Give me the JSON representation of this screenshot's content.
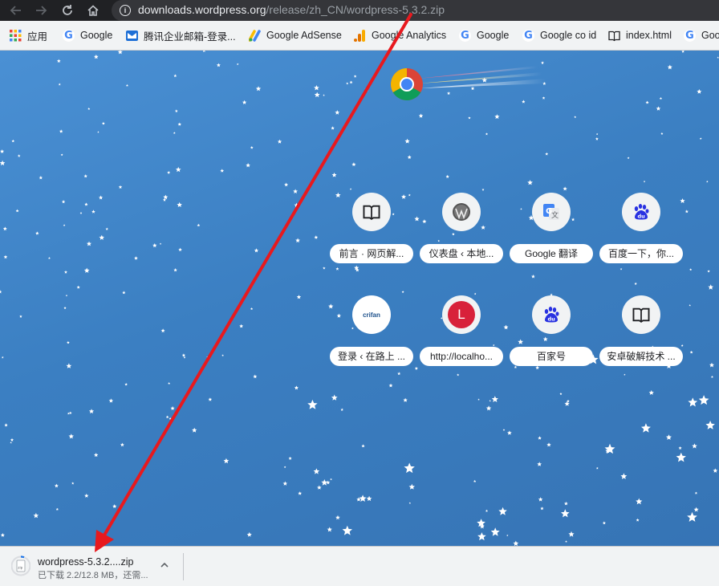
{
  "omnibox": {
    "host": "downloads.wordpress.org",
    "path": "/release/zh_CN/wordpress-5.3.2.zip"
  },
  "bookmarks": [
    {
      "label": "应用",
      "icon": "apps-grid-icon"
    },
    {
      "label": "Google",
      "icon": "google-icon"
    },
    {
      "label": "腾讯企业邮箱-登录...",
      "icon": "tencent-mail-icon"
    },
    {
      "label": "Google AdSense",
      "icon": "adsense-icon"
    },
    {
      "label": "Google Analytics",
      "icon": "analytics-icon"
    },
    {
      "label": "Google",
      "icon": "google-icon"
    },
    {
      "label": "Google co id",
      "icon": "google-icon"
    },
    {
      "label": "index.html",
      "icon": "book-icon"
    },
    {
      "label": "Goo",
      "icon": "google-icon"
    }
  ],
  "shortcuts": [
    {
      "label": "前言 · 网页解...",
      "icon": "book-icon"
    },
    {
      "label": "仪表盘 ‹ 本地...",
      "icon": "wordpress-icon"
    },
    {
      "label": "Google 翻译",
      "icon": "google-translate-icon"
    },
    {
      "label": "百度一下，你...",
      "icon": "baidu-icon"
    },
    {
      "label": "登录 ‹ 在路上 ...",
      "icon": "crifan-icon",
      "icon_text": "crifan"
    },
    {
      "label": "http://localho...",
      "icon": "letter-l-icon",
      "icon_text": "L"
    },
    {
      "label": "百家号",
      "icon": "baidu-icon"
    },
    {
      "label": "安卓破解技术 ...",
      "icon": "book-icon"
    }
  ],
  "download": {
    "filename": "wordpress-5.3.2....zip",
    "status": "已下载 2.2/12.8 MB，还需...",
    "file_icon_text": "zip"
  },
  "colors": {
    "annotation_arrow": "#e8191e",
    "toolbar_bg": "#202124",
    "ntp_bg": "#3b7fc2"
  }
}
